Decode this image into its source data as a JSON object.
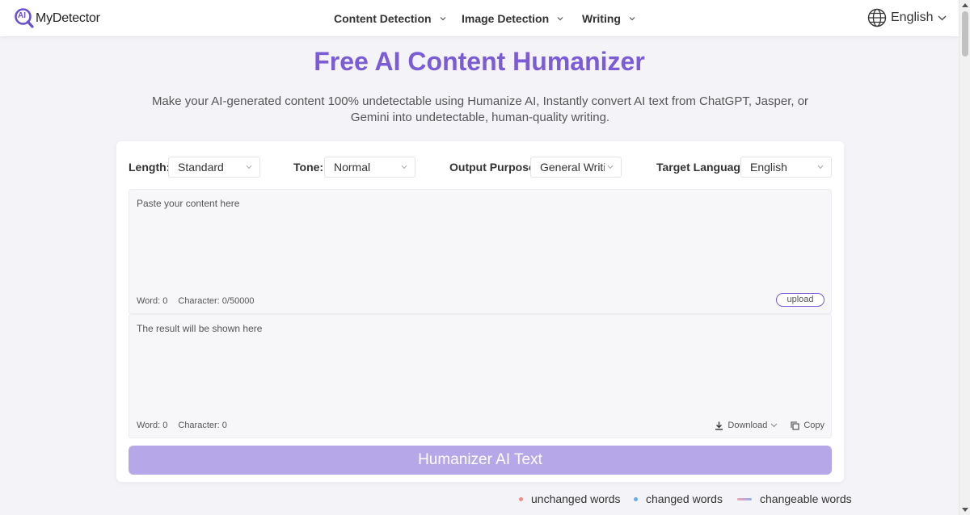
{
  "header": {
    "logo_text": "MyDetector",
    "logo_badge": "AI",
    "nav": [
      {
        "label": "Content Detection"
      },
      {
        "label": "Image Detection"
      },
      {
        "label": "Writing"
      }
    ],
    "language": "English"
  },
  "hero": {
    "title": "Free AI Content Humanizer",
    "subtitle": "Make your AI-generated content 100% undetectable using Humanize AI, Instantly convert AI text from ChatGPT, Jasper, or Gemini into undetectable, human-quality writing."
  },
  "options": {
    "length": {
      "label": "Length:",
      "value": "Standard"
    },
    "tone": {
      "label": "Tone:",
      "value": "Normal"
    },
    "purpose": {
      "label": "Output Purpose:",
      "value": "General Writing"
    },
    "language": {
      "label": "Target Language:",
      "value": "English"
    }
  },
  "input": {
    "placeholder": "Paste your content here",
    "word_label": "Word: 0",
    "char_label": "Character: 0/50000",
    "upload_label": "upload"
  },
  "output": {
    "placeholder": "The result will be shown here",
    "word_label": "Word: 0",
    "char_label": "Character: 0",
    "download_label": "Download",
    "copy_label": "Copy"
  },
  "humanize_button": "Humanizer AI Text",
  "legend": {
    "unchanged": "unchanged words",
    "changed": "changed words",
    "changeable": "changeable words"
  },
  "colors": {
    "accent": "#7b5bd6",
    "button_disabled": "#b6a8e8",
    "unchanged_dot": "#f08a8a",
    "changed_dot": "#6aa8ec",
    "changeable_start": "#f5a0b8",
    "changeable_end": "#8fb0f0"
  },
  "icons": {
    "logo": "ai-magnifier-icon",
    "language": "globe-icon",
    "download": "download-icon",
    "copy": "copy-icon"
  }
}
